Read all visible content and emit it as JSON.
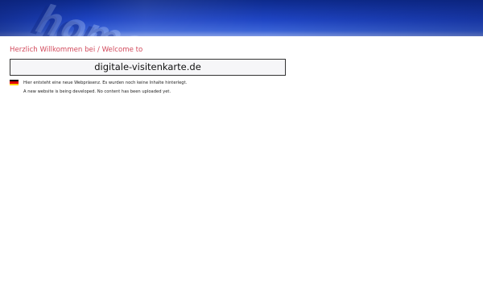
{
  "header": {
    "banner_watermark": "home",
    "colors": {
      "banner_dark": "#0d2a8c",
      "banner_mid": "#1f45c4",
      "banner_light": "#7d97e2"
    }
  },
  "main": {
    "welcome_heading": "Herzlich Willkommen bei / Welcome to",
    "domain": "digitale-visitenkarte.de",
    "colors": {
      "heading": "#d24a5c",
      "box_border": "#333333",
      "box_background": "#f6f6f8"
    },
    "messages": [
      {
        "flag_icon": "german-flag-icon",
        "text": "Hier entsteht eine neue Webpräsenz. Es wurden noch keine Inhalte hinterlegt."
      },
      {
        "flag_icon": "uk-flag-icon",
        "text": "A new website is being developed. No content has been uploaded yet."
      }
    ]
  }
}
